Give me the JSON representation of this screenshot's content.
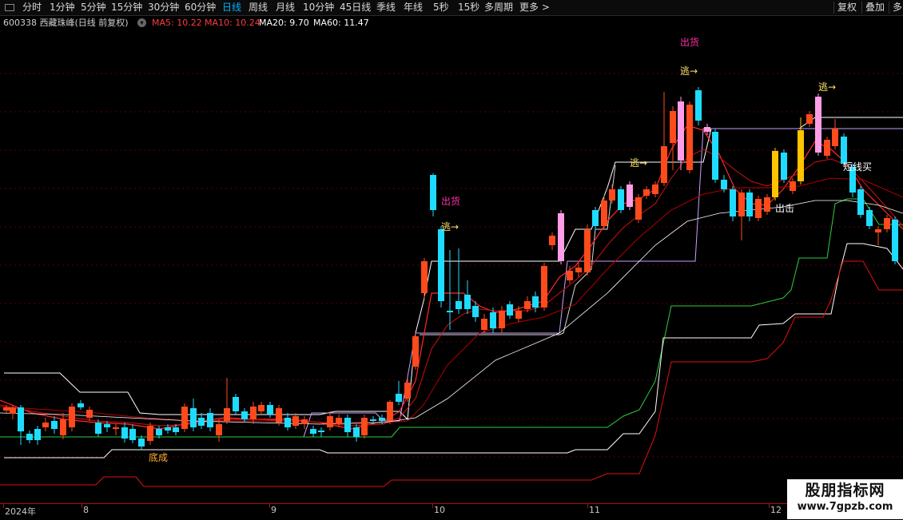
{
  "toolbar": {
    "periods": [
      "分时",
      "1分钟",
      "5分钟",
      "15分钟",
      "30分钟",
      "60分钟",
      "日线",
      "周线",
      "月线",
      "10分钟",
      "45日线",
      "季线",
      "年线",
      "5秒",
      "15秒",
      "多周期",
      "更多 >"
    ],
    "active_period": "日线",
    "right_buttons": [
      "复权",
      "叠加",
      "多"
    ]
  },
  "info": {
    "stock": "600338 西藏珠峰(日线 前复权)",
    "ma": [
      {
        "label": "MA5: 10.22",
        "color": "#ff3b3b"
      },
      {
        "label": "MA10: 10.24",
        "color": "#ff3b3b"
      },
      {
        "label": "MA20: 9.70",
        "color": "#ffffff"
      },
      {
        "label": "MA60: 11.47",
        "color": "#ffffff"
      }
    ]
  },
  "annotations": [
    {
      "text": "出货",
      "color": "#ff2ea6"
    },
    {
      "text": "逃→",
      "color": "#ffe066"
    },
    {
      "text": "出货",
      "color": "#ff2ea6"
    },
    {
      "text": "逃→",
      "color": "#ffe066"
    },
    {
      "text": "逃→",
      "color": "#ffe066"
    },
    {
      "text": "逃→",
      "color": "#ffe066"
    },
    {
      "text": "短线买",
      "color": "#ffffff"
    },
    {
      "text": "出击",
      "color": "#ffffff"
    },
    {
      "text": "底成",
      "color": "#ffb030"
    }
  ],
  "dates": [
    "2024年",
    "8",
    "9",
    "10",
    "11",
    "12"
  ],
  "watermark": {
    "title": "股朋指标网",
    "url": "www.7gpzb.com"
  },
  "colors": {
    "up": "#ff4a1c",
    "down": "#1edcff",
    "pink": "#ff9ee6",
    "gold": "#ffc400",
    "ma_red": "#ff2020",
    "grid": "#5a0000"
  }
}
